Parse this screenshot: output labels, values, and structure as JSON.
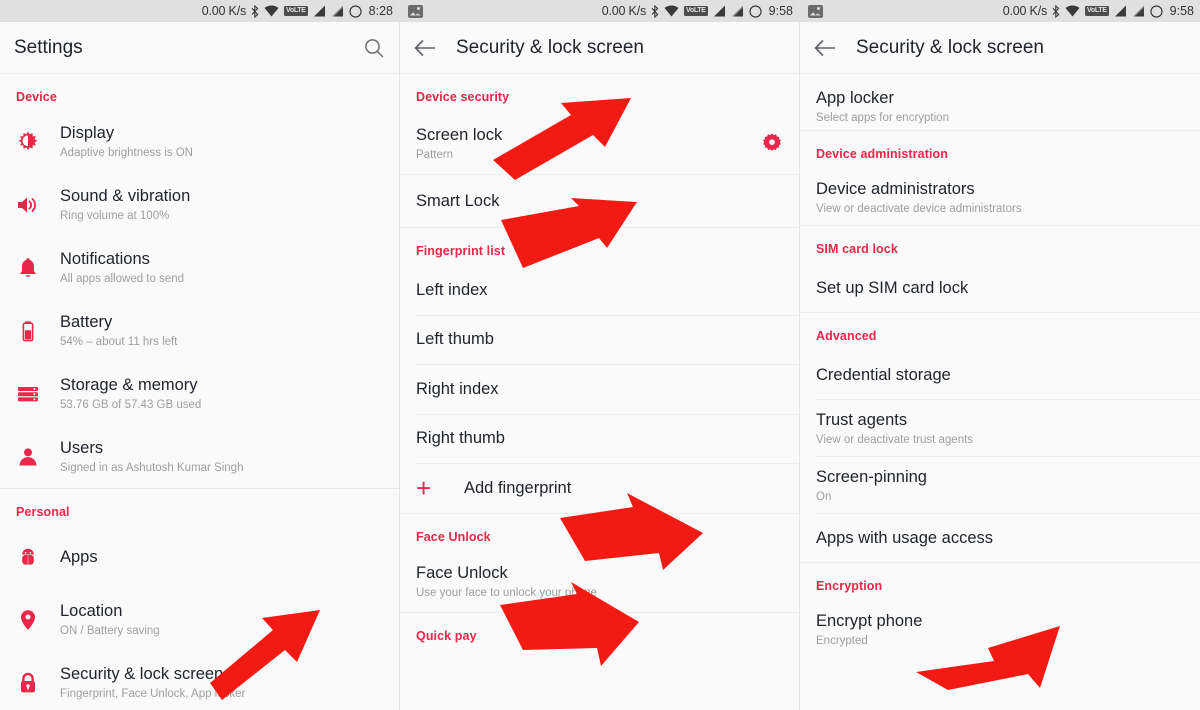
{
  "accent_color": "#e8274b",
  "panels": [
    {
      "name": "settings-home",
      "statusbar": {
        "speed": "0.00 K/s",
        "volte": "VoLTE",
        "time": "8:28"
      },
      "appbar": {
        "title": "Settings"
      },
      "sections": [
        {
          "header": "Device",
          "items": [
            {
              "icon": "brightness-icon",
              "title": "Display",
              "subtitle": "Adaptive brightness is ON"
            },
            {
              "icon": "volume-icon",
              "title": "Sound & vibration",
              "subtitle": "Ring volume at 100%"
            },
            {
              "icon": "bell-icon",
              "title": "Notifications",
              "subtitle": "All apps allowed to send"
            },
            {
              "icon": "battery-icon",
              "title": "Battery",
              "subtitle": "54% – about 11 hrs left"
            },
            {
              "icon": "storage-icon",
              "title": "Storage & memory",
              "subtitle": "53.76 GB of 57.43 GB used"
            },
            {
              "icon": "user-icon",
              "title": "Users",
              "subtitle": "Signed in as Ashutosh Kumar Singh"
            }
          ]
        },
        {
          "header": "Personal",
          "items": [
            {
              "icon": "android-icon",
              "title": "Apps",
              "subtitle": ""
            },
            {
              "icon": "location-pin-icon",
              "title": "Location",
              "subtitle": "ON / Battery saving"
            },
            {
              "icon": "lock-icon",
              "title": "Security & lock screen",
              "subtitle": "Fingerprint, Face Unlock, App locker"
            }
          ]
        }
      ]
    },
    {
      "name": "security-lock-screen-top",
      "statusbar": {
        "speed": "0.00 K/s",
        "volte": "VoLTE",
        "time": "9:58"
      },
      "appbar": {
        "title": "Security & lock screen"
      },
      "sections": [
        {
          "header": "Device security",
          "items": [
            {
              "title": "Screen lock",
              "subtitle": "Pattern",
              "trailing": "gear-icon"
            },
            {
              "title": "Smart Lock",
              "subtitle": ""
            }
          ]
        },
        {
          "header": "Fingerprint list",
          "items": [
            {
              "title": "Left index",
              "subtitle": ""
            },
            {
              "title": "Left thumb",
              "subtitle": ""
            },
            {
              "title": "Right index",
              "subtitle": ""
            },
            {
              "title": "Right thumb",
              "subtitle": ""
            },
            {
              "title": "Add fingerprint",
              "subtitle": "",
              "leading": "plus-icon"
            }
          ]
        },
        {
          "header": "Face Unlock",
          "items": [
            {
              "title": "Face Unlock",
              "subtitle": "Use your face to unlock your phone"
            }
          ]
        },
        {
          "header": "Quick pay",
          "items": []
        }
      ]
    },
    {
      "name": "security-lock-screen-bottom",
      "statusbar": {
        "speed": "0.00 K/s",
        "volte": "VoLTE",
        "time": "9:58"
      },
      "appbar": {
        "title": "Security & lock screen"
      },
      "sections": [
        {
          "header": "",
          "items": [
            {
              "title": "App locker",
              "subtitle": "Select apps for encryption"
            }
          ]
        },
        {
          "header": "Device administration",
          "items": [
            {
              "title": "Device administrators",
              "subtitle": "View or deactivate device administrators"
            }
          ]
        },
        {
          "header": "SIM card lock",
          "items": [
            {
              "title": "Set up SIM card lock",
              "subtitle": ""
            }
          ]
        },
        {
          "header": "Advanced",
          "items": [
            {
              "title": "Credential storage",
              "subtitle": ""
            },
            {
              "title": "Trust agents",
              "subtitle": "View or deactivate trust agents"
            },
            {
              "title": "Screen-pinning",
              "subtitle": "On"
            },
            {
              "title": "Apps with usage access",
              "subtitle": ""
            }
          ]
        },
        {
          "header": "Encryption",
          "items": [
            {
              "title": "Encrypt phone",
              "subtitle": "Encrypted"
            }
          ]
        }
      ]
    }
  ],
  "annotations": {
    "arrow_color": "#f41a14",
    "arrows": [
      {
        "name": "arrow-security-lock-screen",
        "points_to": "Security & lock screen"
      },
      {
        "name": "arrow-screen-lock",
        "points_to": "Screen lock"
      },
      {
        "name": "arrow-smart-lock",
        "points_to": "Smart Lock"
      },
      {
        "name": "arrow-add-fingerprint",
        "points_to": "Add fingerprint"
      },
      {
        "name": "arrow-face-unlock",
        "points_to": "Face Unlock"
      },
      {
        "name": "arrow-encrypt-phone",
        "points_to": "Encrypt phone"
      }
    ]
  }
}
